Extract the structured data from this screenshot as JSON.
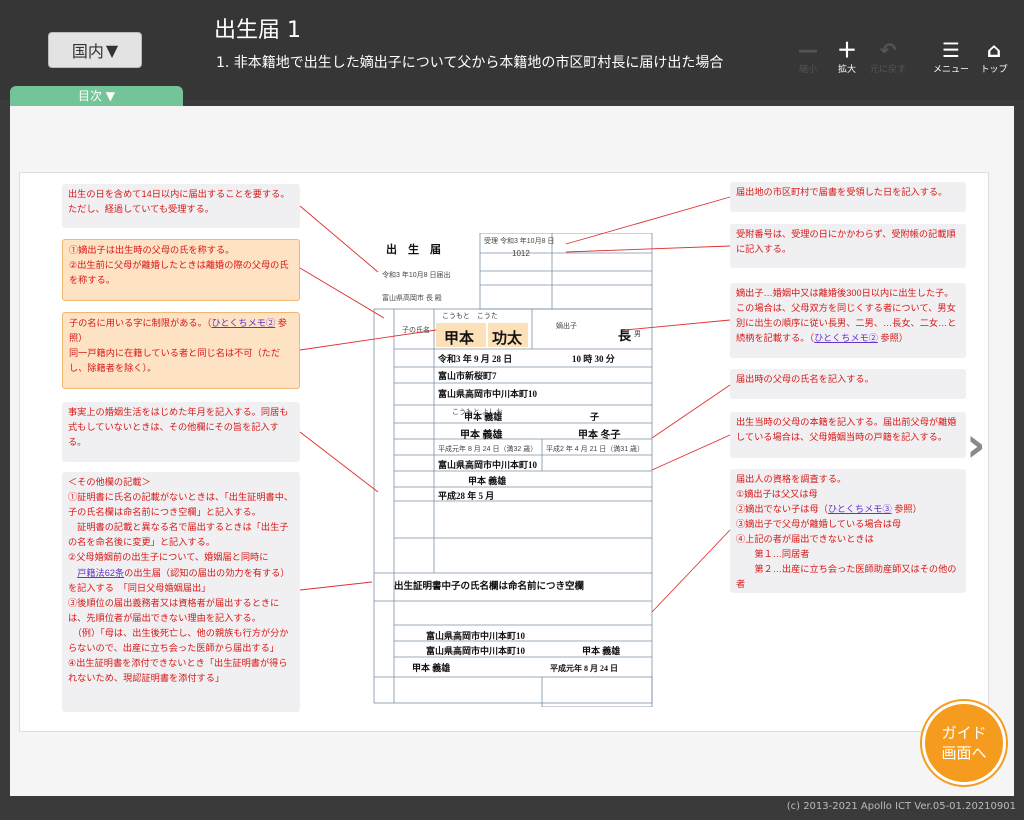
{
  "header": {
    "region_label": "国内",
    "title": "出生届 1",
    "subtitle": "1. 非本籍地で出生した嫡出子について父から本籍地の市区町村長に届け出た場合"
  },
  "tools": [
    {
      "icon": "minus-icon",
      "label": "縮小"
    },
    {
      "icon": "plus-icon",
      "label": "拡大"
    },
    {
      "icon": "undo-icon",
      "label": "元に戻す"
    },
    {
      "icon": "menu-icon",
      "label": "メニュー"
    },
    {
      "icon": "home-icon",
      "label": "トップ"
    }
  ],
  "tab": {
    "label": "目次"
  },
  "notes_left": [
    {
      "text": "出生の日を含めて14日以内に届出することを要する。ただし、経過していても受理する。"
    },
    {
      "text": "①嫡出子は出生時の父母の氏を称する。\n②出生前に父母が離婚したときは離婚の際の父母の氏を称する。"
    },
    {
      "pre": "子の名に用いる字に制限がある。（",
      "link": "ひとくちメモ②",
      "post": " 参照）\n同一戸籍内に在籍している者と同じ名は不可（ただし、除籍者を除く）。"
    },
    {
      "text": "事実上の婚姻生活をはじめた年月を記入する。同居も式もしていないときは、その他欄にその旨を記入する。"
    },
    {
      "pre": "＜その他欄の記載＞\n①証明書に氏名の記載がないときは、「出生証明書中、子の氏名欄は命名前につき空欄」と記入する。\n　証明書の記載と異なる名で届出するときは「出生子の名を命名後に変更」と記入する。\n②父母婚姻前の出生子について、婚姻届と同時に\n　",
      "link": "戸籍法62条",
      "post": "の出生届（認知の届出の効力を有する）を記入する　「同日父母婚姻届出」\n③後順位の届出義務者又は資格者が届出するときには、先順位者が届出できない理由を記入する。\n　（例）「母は、出生後死亡し、他の親族も行方が分からないので、出産に立ち会った医師から届出する」\n④出生証明書を添付できないとき「出生証明書が得られないため、現認証明書を添付する」"
    }
  ],
  "notes_right": [
    {
      "text": "届出地の市区町村で届書を受領した日を記入する。"
    },
    {
      "text": "受附番号は、受理の日にかかわらず、受附帳の記載順に記入する。"
    },
    {
      "pre": "嫡出子…婚姻中又は離婚後300日以内に出生した子。この場合は、父母双方を同じくする者について、男女別に出生の順序に従い長男、二男、…長女、二女…と続柄を記載する。（",
      "link": "ひとくちメモ②",
      "post": " 参照）"
    },
    {
      "text": "届出時の父母の氏名を記入する。"
    },
    {
      "text": "出生当時の父母の本籍を記入する。届出前父母が離婚している場合は、父母婚姻当時の戸籍を記入する。"
    },
    {
      "pre": "届出人の資格を調査する。\n①嫡出子は父又は母\n②嫡出でない子は母（",
      "link": "ひとくちメモ③",
      "post": " 参照）\n③嫡出子で父母が離婚している場合は母\n④上記の者が届出できないときは\n　　第１…同居者\n　　第２…出産に立ち会った医師助産師又はその他の者"
    }
  ],
  "form": {
    "title": "出　生　届",
    "date": "令和3 年10月8 日届出",
    "addressee": "富山県高岡市 長 殿",
    "received": "受理 令和3 年10月8 日",
    "number": "1012",
    "furigana_child": "こうもと　こうた",
    "child_surname": "甲本",
    "child_given": "功太",
    "relation_box": "嫡出子",
    "relation": "長",
    "gender": "男",
    "birth_date": "令和3 年 9 月 28 日",
    "birth_time": "10 時 30 分",
    "birth_place": "富山市新桜町7",
    "address": "富山県高岡市中川本町10",
    "householder_furi": "こうもと よしお",
    "householder": "甲本 義雄",
    "householder_rel": "子",
    "father": "甲本 義雄",
    "mother": "甲本 冬子",
    "father_dob": "平成元年 8 月 24 日（満32 歳）",
    "mother_dob": "平成2 年 4 月 21 日（満31 歳）",
    "honseki": "富山県高岡市中川本町10",
    "honseki_head": "甲本 義雄",
    "cohabit": "平成28 年 5 月",
    "other": "出生証明書中子の氏名欄は命名前につき空欄",
    "reporter_address": "富山県高岡市中川本町10",
    "reporter_honseki": "富山県高岡市中川本町10",
    "reporter_head": "甲本 義雄",
    "reporter_name": "甲本 義雄",
    "reporter_dob": "平成元年 8 月 24 日"
  },
  "guide_button": "ガイド\n画面へ",
  "footer": "(c) 2013-2021 Apollo ICT  Ver.05-01.20210901"
}
